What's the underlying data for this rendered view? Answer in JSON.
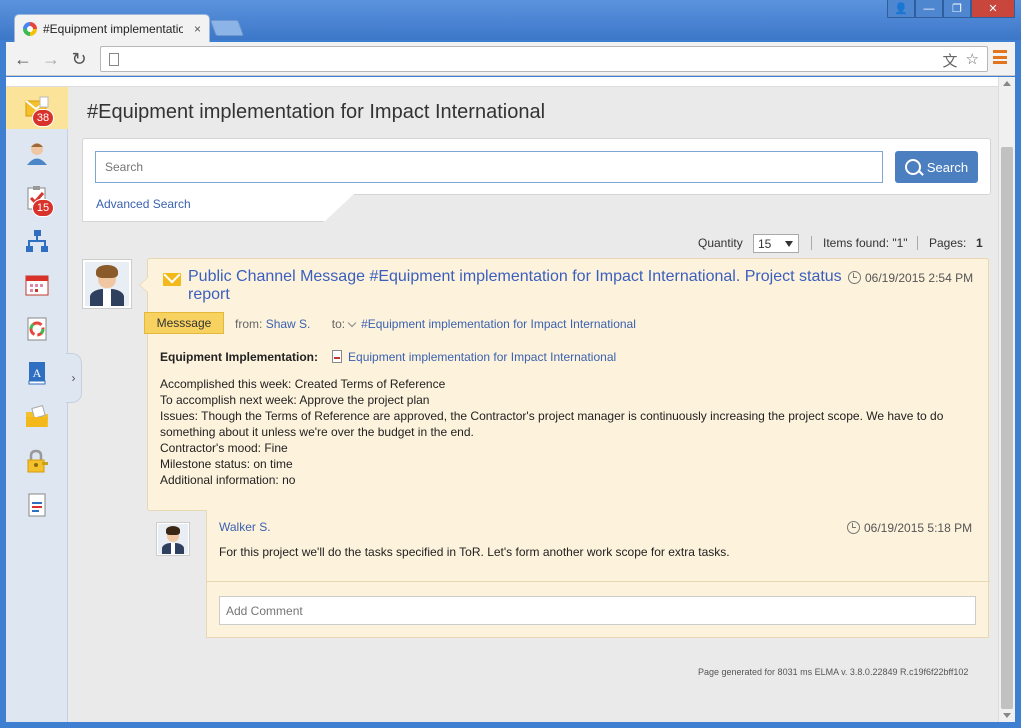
{
  "browser": {
    "tab_title": "#Equipment implementation",
    "tab_close": "×",
    "address": "",
    "win_user": "👤",
    "win_min": "—",
    "win_max": "❐",
    "win_close": "✕",
    "back": "←",
    "forward": "→",
    "reload": "↻",
    "translate_icon": "文",
    "star_icon": "☆"
  },
  "sidebar": {
    "items": [
      {
        "icon": "messages-icon",
        "badge": "38",
        "active": true
      },
      {
        "icon": "user-icon",
        "badge": "",
        "active": false
      },
      {
        "icon": "tasks-icon",
        "badge": "15",
        "active": false
      },
      {
        "icon": "org-structure-icon",
        "badge": "",
        "active": false
      },
      {
        "icon": "calendar-icon",
        "badge": "",
        "active": false
      },
      {
        "icon": "processes-icon",
        "badge": "",
        "active": false
      },
      {
        "icon": "knowledge-book-icon",
        "badge": "",
        "active": false
      },
      {
        "icon": "documents-folder-icon",
        "badge": "",
        "active": false
      },
      {
        "icon": "lock-key-icon",
        "badge": "",
        "active": false
      },
      {
        "icon": "report-icon",
        "badge": "",
        "active": false
      }
    ],
    "collapse_glyph": "›"
  },
  "page": {
    "title": "#Equipment implementation for Impact International"
  },
  "search": {
    "placeholder": "Search",
    "button_label": "Search",
    "advanced_label": "Advanced Search"
  },
  "pager": {
    "quantity_label": "Quantity",
    "quantity_value": "15",
    "items_found_label": "Items found: \"1\"",
    "pages_label": "Pages:",
    "pages_value": "1"
  },
  "message": {
    "title": "Public Channel Message #Equipment implementation for Impact International. Project status report",
    "date": "06/19/2015 2:54 PM",
    "type_label": "Messsage",
    "from_label": "from:",
    "from_name": "Shaw S.",
    "to_label": "to:",
    "to_name": "#Equipment implementation for Impact International",
    "field_label": "Equipment Implementation:",
    "field_value": "Equipment implementation for Impact International",
    "body": [
      "Accomplished this week: Created Terms of Reference",
      "To accomplish next week: Approve the project plan",
      "Issues: Though the Terms of Reference are approved, the Contractor's project manager is continuously increasing the project scope. We have to do something about it unless we're over the budget in the end.",
      "Contractor's mood: Fine",
      "Milestone status: on time",
      "Additional information: no"
    ]
  },
  "comment": {
    "author": "Walker S.",
    "date": "06/19/2015 5:18 PM",
    "text": "For this project we'll do the tasks specified in ToR. Let's form another work scope for extra tasks.",
    "add_placeholder": "Add Comment"
  },
  "footer": {
    "note": "Page generated for 8031 ms ELMA v. 3.8.0.22849 R.c19f6f22bff102"
  }
}
